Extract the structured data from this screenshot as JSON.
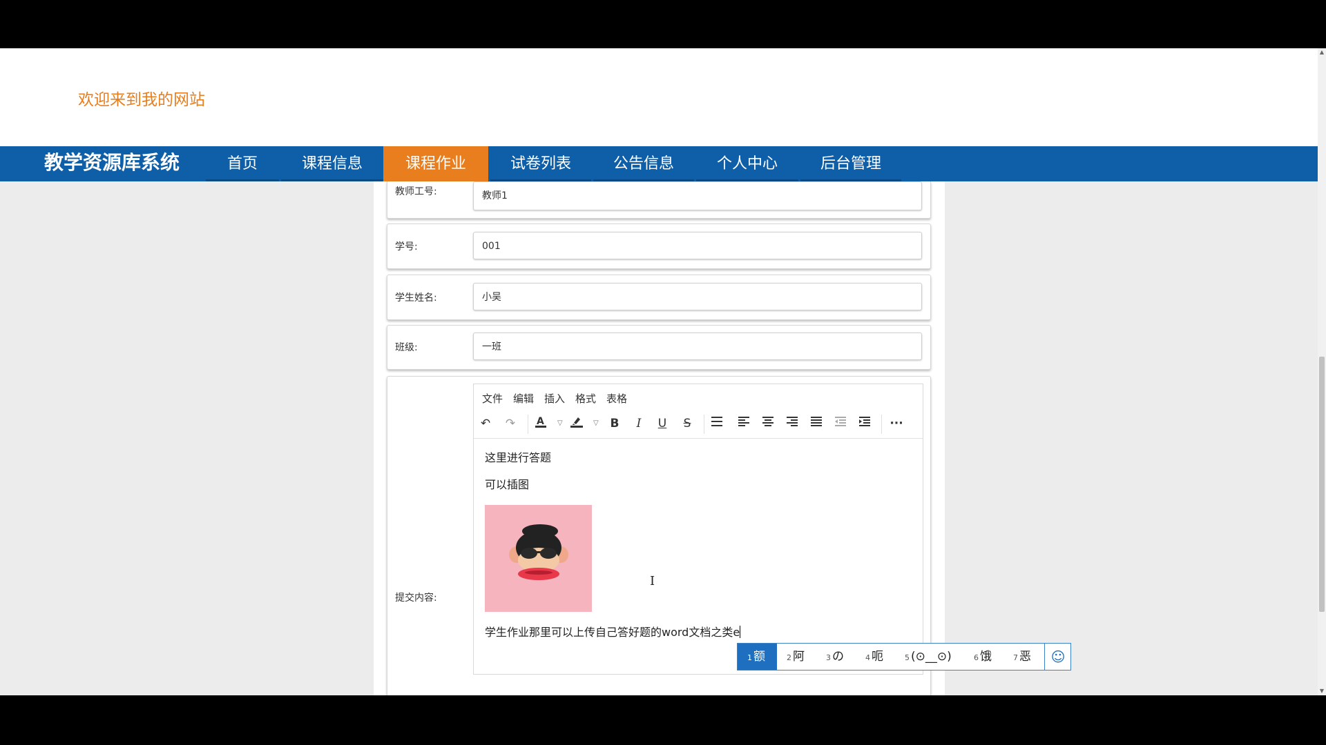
{
  "site": {
    "welcome": "欢迎来到我的网站",
    "brand": "教学资源库系统"
  },
  "nav": {
    "items": [
      {
        "label": "首页"
      },
      {
        "label": "课程信息"
      },
      {
        "label": "课程作业",
        "active": true
      },
      {
        "label": "试卷列表"
      },
      {
        "label": "公告信息"
      },
      {
        "label": "个人中心"
      },
      {
        "label": "后台管理"
      }
    ]
  },
  "form": {
    "teacher_id": {
      "label": "教师工号:",
      "value": "教师1"
    },
    "student_id": {
      "label": "学号:",
      "value": "001"
    },
    "student_name": {
      "label": "学生姓名:",
      "value": "小吴"
    },
    "class": {
      "label": "班级:",
      "value": "一班"
    },
    "content": {
      "label": "提交内容:"
    }
  },
  "editor": {
    "menu": [
      "文件",
      "编辑",
      "插入",
      "格式",
      "表格"
    ],
    "toolbar_icons": [
      "undo-icon",
      "redo-icon",
      "font-color-icon",
      "highlight-color-icon",
      "bold-icon",
      "italic-icon",
      "underline-icon",
      "strikethrough-icon",
      "list-icon",
      "align-left-icon",
      "align-center-icon",
      "align-right-icon",
      "align-justify-icon",
      "outdent-icon",
      "indent-icon",
      "more-icon"
    ],
    "paragraphs": [
      "这里进行答题",
      "可以插图"
    ],
    "typing_line": "学生作业那里可以上传自己答好题的word文档之类e"
  },
  "ime": {
    "candidates": [
      {
        "num": "1",
        "text": "额",
        "selected": true
      },
      {
        "num": "2",
        "text": "阿"
      },
      {
        "num": "3",
        "text": "の"
      },
      {
        "num": "4",
        "text": "呃"
      },
      {
        "num": "5",
        "text": "(⊙__⊙)"
      },
      {
        "num": "6",
        "text": "饿"
      },
      {
        "num": "7",
        "text": "恶"
      }
    ],
    "emoji_icon": "smiley-icon"
  },
  "colors": {
    "nav_bg": "#0f5fa8",
    "nav_active": "#e87e1e",
    "welcome_text": "#e87e1e",
    "ime_selected": "#1e6fbf"
  }
}
